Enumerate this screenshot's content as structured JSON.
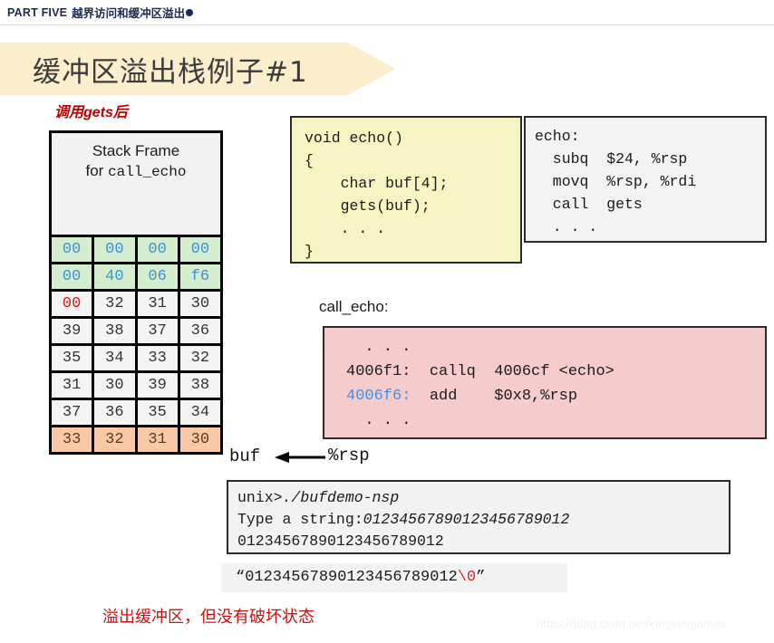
{
  "header": {
    "part_label": "PART FIVE",
    "subtitle": "越界访问和缓冲区溢出",
    "bullet_icon": "filled-circle-icon"
  },
  "banner": {
    "title": "缓冲区溢出栈例子#1"
  },
  "annotations": {
    "top_note": "调用gets后",
    "bottom_note": "溢出缓冲区，但没有破坏状态"
  },
  "stack": {
    "header_line1": "Stack Frame",
    "header_line2_prefix": "for ",
    "header_line2_mono": "call_echo",
    "rows": [
      {
        "style": "green",
        "cells": [
          "00",
          "00",
          "00",
          "00"
        ],
        "red_cells": []
      },
      {
        "style": "green",
        "cells": [
          "00",
          "40",
          "06",
          "f6"
        ],
        "red_cells": []
      },
      {
        "style": "white",
        "cells": [
          "00",
          "32",
          "31",
          "30"
        ],
        "red_cells": [
          0
        ]
      },
      {
        "style": "white",
        "cells": [
          "39",
          "38",
          "37",
          "36"
        ],
        "red_cells": []
      },
      {
        "style": "white",
        "cells": [
          "35",
          "34",
          "33",
          "32"
        ],
        "red_cells": []
      },
      {
        "style": "white",
        "cells": [
          "31",
          "30",
          "39",
          "38"
        ],
        "red_cells": []
      },
      {
        "style": "white",
        "cells": [
          "37",
          "36",
          "35",
          "34"
        ],
        "red_cells": []
      },
      {
        "style": "orange",
        "cells": [
          "33",
          "32",
          "31",
          "30"
        ],
        "red_cells": []
      }
    ],
    "buf_label": "buf",
    "rsp_label": "%rsp",
    "pointer_icon": "left-arrow-icon"
  },
  "c_code": {
    "lines": [
      "void echo()",
      "{",
      "    char buf[4];",
      "    gets(buf);",
      "    . . .",
      "}"
    ]
  },
  "asm_echo": {
    "lines": [
      "echo:",
      "  subq  $24, %rsp",
      "  movq  %rsp, %rdi",
      "  call  gets",
      "  . . ."
    ]
  },
  "call_echo": {
    "label": "call_echo:",
    "line_dots_top": "  . . .",
    "line_call_addr": "4006f1:",
    "line_call_rest": "  callq  4006cf <echo>",
    "line_ret_addr": "4006f6:",
    "line_ret_rest": "  add    $0x8,%rsp",
    "line_dots_bottom": "  . . ."
  },
  "terminal": {
    "line1_prompt": "unix>",
    "line1_cmd": "./bufdemo-nsp",
    "line2_prompt": "Type a string:",
    "line2_input": "01234567890123456789012",
    "line3": "01234567890123456789012"
  },
  "string_literal": {
    "open_quote": "“",
    "body": "01234567890123456789012",
    "nul": "\\0",
    "close_quote": "”"
  },
  "watermark": {
    "text": "https://blog.csdn.net/kingvingjames"
  },
  "colors": {
    "banner_bg": "#fbeecd",
    "c_box_bg": "#f7f4c4",
    "pink_box_bg": "#f5cbcb",
    "row_green": "#d4edce",
    "row_orange": "#f8c9a4",
    "accent_red": "#cc1111",
    "accent_blue": "#4a90d9",
    "header_navy": "#1b2a52"
  }
}
